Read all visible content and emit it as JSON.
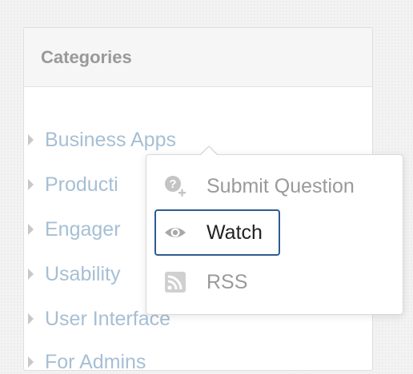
{
  "panel": {
    "title": "Categories"
  },
  "categories": [
    {
      "label": "Business Apps"
    },
    {
      "label": "Producti"
    },
    {
      "label": "Engager"
    },
    {
      "label": "Usability"
    },
    {
      "label": "User Interface"
    },
    {
      "label": "For Admins"
    }
  ],
  "context_menu": {
    "items": [
      {
        "label": "Submit Question",
        "icon": "question-plus-icon",
        "state": "disabled"
      },
      {
        "label": "Watch",
        "icon": "eye-icon",
        "state": "selected"
      },
      {
        "label": "RSS",
        "icon": "rss-icon",
        "state": "disabled"
      }
    ]
  },
  "colors": {
    "link": "#a6bfd4",
    "selection_border": "#2e5b8e",
    "disabled_text": "#9a9a9a"
  }
}
